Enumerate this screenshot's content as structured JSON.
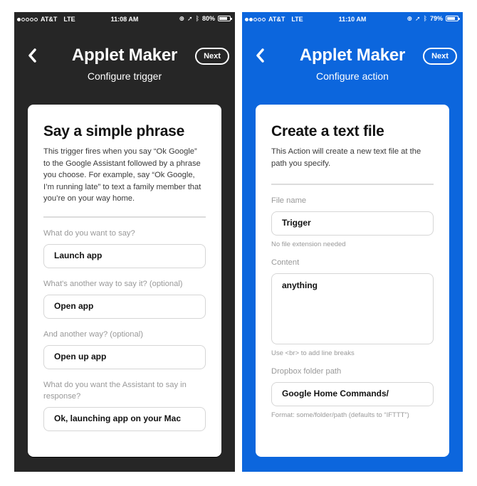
{
  "screens": [
    {
      "status": {
        "signal_bars_filled": 1,
        "signal_bars_total": 5,
        "carrier": "AT&T",
        "network": "LTE",
        "time": "11:08 AM",
        "battery_percent": 80,
        "battery_label": "80%"
      },
      "nav": {
        "back_icon": "chevron-left-icon",
        "title": "Applet Maker",
        "subtitle": "Configure trigger",
        "next_label": "Next"
      },
      "background_color": "#262626",
      "card": {
        "heading": "Say a simple phrase",
        "description": "This trigger fires when you say “Ok Google” to the Google Assistant followed by a phrase you choose. For example, say “Ok Google, I’m running late” to text a family member that you’re on your way home.",
        "fields": [
          {
            "label": "What do you want to say?",
            "value": "Launch app"
          },
          {
            "label": "What's another way to say it? (optional)",
            "value": "Open app"
          },
          {
            "label": "And another way? (optional)",
            "value": "Open up app"
          },
          {
            "label": "What do you want the Assistant to say in response?",
            "value": "Ok, launching app on your Mac"
          }
        ]
      }
    },
    {
      "status": {
        "signal_bars_filled": 2,
        "signal_bars_total": 5,
        "carrier": "AT&T",
        "network": "LTE",
        "time": "11:10 AM",
        "battery_percent": 79,
        "battery_label": "79%"
      },
      "nav": {
        "back_icon": "chevron-left-icon",
        "title": "Applet Maker",
        "subtitle": "Configure action",
        "next_label": "Next"
      },
      "background_color": "#0c66dd",
      "card": {
        "heading": "Create a text file",
        "description": "This Action will create a new text file at the path you specify.",
        "fields": [
          {
            "label": "File name",
            "value": "Trigger",
            "hint": "No file extension needed"
          },
          {
            "label": "Content",
            "value": "anything",
            "hint": "Use <br> to add line breaks"
          },
          {
            "label": "Dropbox folder path",
            "value": "Google Home Commands/",
            "hint": "Format: some/folder/path (defaults to “IFTTT”)"
          }
        ]
      }
    }
  ]
}
